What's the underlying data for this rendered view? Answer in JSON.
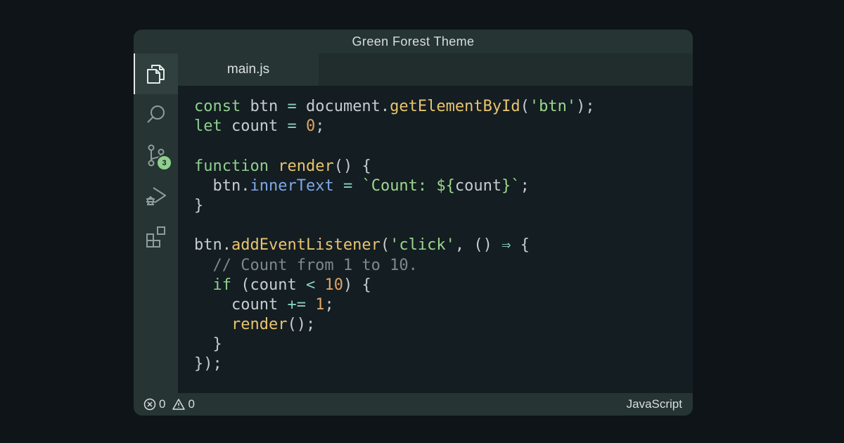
{
  "window": {
    "title": "Green Forest Theme"
  },
  "activity_bar": {
    "items": [
      {
        "name": "explorer",
        "icon": "files-icon",
        "active": true
      },
      {
        "name": "search",
        "icon": "search-icon"
      },
      {
        "name": "source-control",
        "icon": "source-control-icon",
        "badge": "3"
      },
      {
        "name": "run-debug",
        "icon": "run-debug-icon"
      },
      {
        "name": "extensions",
        "icon": "extensions-icon"
      }
    ]
  },
  "tabs": [
    {
      "label": "main.js",
      "active": true
    }
  ],
  "code": {
    "lines": [
      [
        {
          "t": "const",
          "c": "kw"
        },
        {
          "t": " btn ",
          "c": "tx"
        },
        {
          "t": "=",
          "c": "op"
        },
        {
          "t": " document.",
          "c": "tx"
        },
        {
          "t": "getElementById",
          "c": "fn"
        },
        {
          "t": "(",
          "c": "tx"
        },
        {
          "t": "'btn'",
          "c": "str"
        },
        {
          "t": ");",
          "c": "tx"
        }
      ],
      [
        {
          "t": "let",
          "c": "kw"
        },
        {
          "t": " count ",
          "c": "tx"
        },
        {
          "t": "=",
          "c": "op"
        },
        {
          "t": " ",
          "c": "tx"
        },
        {
          "t": "0",
          "c": "num"
        },
        {
          "t": ";",
          "c": "tx"
        }
      ],
      [],
      [
        {
          "t": "function",
          "c": "kw"
        },
        {
          "t": " ",
          "c": "tx"
        },
        {
          "t": "render",
          "c": "fn"
        },
        {
          "t": "() {",
          "c": "tx"
        }
      ],
      [
        {
          "t": "  btn.",
          "c": "tx"
        },
        {
          "t": "innerText",
          "c": "prop"
        },
        {
          "t": " ",
          "c": "tx"
        },
        {
          "t": "=",
          "c": "op"
        },
        {
          "t": " ",
          "c": "tx"
        },
        {
          "t": "`Count: ${",
          "c": "str"
        },
        {
          "t": "count",
          "c": "tx"
        },
        {
          "t": "}`",
          "c": "str"
        },
        {
          "t": ";",
          "c": "tx"
        }
      ],
      [
        {
          "t": "}",
          "c": "tx"
        }
      ],
      [],
      [
        {
          "t": "btn.",
          "c": "tx"
        },
        {
          "t": "addEventListener",
          "c": "fn"
        },
        {
          "t": "(",
          "c": "tx"
        },
        {
          "t": "'click'",
          "c": "str"
        },
        {
          "t": ", () ",
          "c": "tx"
        },
        {
          "t": "⇒",
          "c": "op"
        },
        {
          "t": " {",
          "c": "tx"
        }
      ],
      [
        {
          "t": "  // Count from 1 to 10.",
          "c": "cm"
        }
      ],
      [
        {
          "t": "  ",
          "c": "tx"
        },
        {
          "t": "if",
          "c": "kw"
        },
        {
          "t": " (count ",
          "c": "tx"
        },
        {
          "t": "<",
          "c": "op"
        },
        {
          "t": " ",
          "c": "tx"
        },
        {
          "t": "10",
          "c": "num"
        },
        {
          "t": ") {",
          "c": "tx"
        }
      ],
      [
        {
          "t": "    count ",
          "c": "tx"
        },
        {
          "t": "+=",
          "c": "op"
        },
        {
          "t": " ",
          "c": "tx"
        },
        {
          "t": "1",
          "c": "num"
        },
        {
          "t": ";",
          "c": "tx"
        }
      ],
      [
        {
          "t": "    ",
          "c": "tx"
        },
        {
          "t": "render",
          "c": "fn"
        },
        {
          "t": "();",
          "c": "tx"
        }
      ],
      [
        {
          "t": "  }",
          "c": "tx"
        }
      ],
      [
        {
          "t": "});",
          "c": "tx"
        }
      ]
    ]
  },
  "status_bar": {
    "errors": "0",
    "warnings": "0",
    "language": "JavaScript"
  },
  "colors": {
    "background": "#0e1418",
    "window": "#263433",
    "editor": "#141d22",
    "keyword": "#8fcf8e",
    "function": "#e8c46e",
    "string": "#9bd88c",
    "number": "#e0a566",
    "operator": "#8ad0c1",
    "property": "#7fa8e8",
    "comment": "#7b8a8c"
  }
}
